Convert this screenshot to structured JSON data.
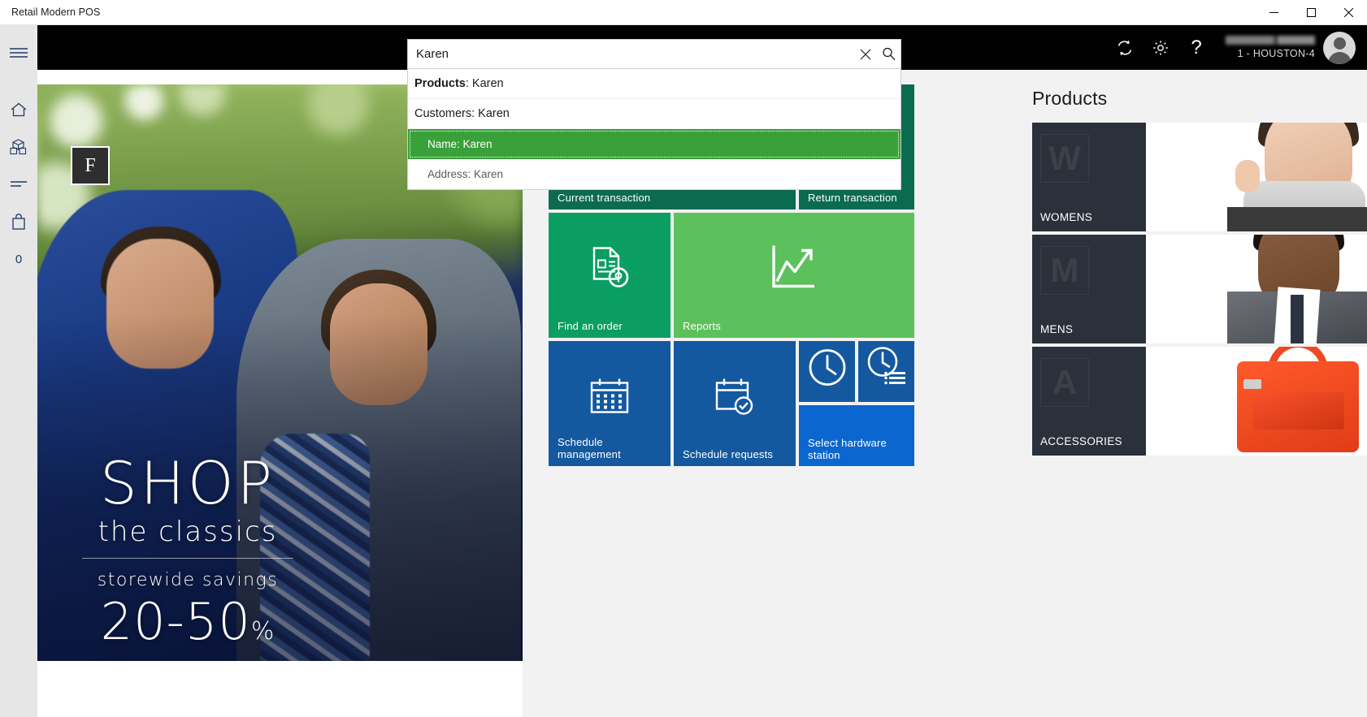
{
  "window": {
    "title": "Retail Modern POS",
    "minimize_label": "Minimize",
    "maximize_label": "Maximize",
    "close_label": "Close"
  },
  "rail": {
    "menu_label": "Menu",
    "items": [
      {
        "name": "home",
        "label": "Home"
      },
      {
        "name": "products",
        "label": "Products"
      },
      {
        "name": "list",
        "label": "Transactions"
      },
      {
        "name": "cart",
        "label": "Cart"
      }
    ],
    "cart_count": "0"
  },
  "search": {
    "value": "Karen",
    "placeholder": "Search",
    "clear_label": "Clear",
    "search_label": "Search",
    "suggestions": [
      {
        "type": "group",
        "bold": "Products",
        "rest": ": Karen"
      },
      {
        "type": "group",
        "bold": "",
        "rest": "Customers: Karen"
      },
      {
        "type": "child",
        "text": "Name: Karen",
        "selected": true
      },
      {
        "type": "child",
        "text": "Address: Karen",
        "selected": false
      }
    ]
  },
  "header": {
    "sync_label": "Sync",
    "settings_label": "Settings",
    "help_label": "Help",
    "user_name": "",
    "store": "1 - HOUSTON-4",
    "avatar_label": "User account"
  },
  "banner": {
    "logo": "F",
    "headline": "SHOP",
    "subhead": "the classics",
    "promo_line": "storewide  savings",
    "discount": "20-50",
    "discount_unit": "%"
  },
  "tiles": [
    {
      "name": "current-transaction",
      "label": "Current transaction",
      "icon": "cart-icon",
      "color": "#0b6b4f"
    },
    {
      "name": "return-transaction",
      "label": "Return transaction",
      "icon": "return-icon",
      "color": "#0b6b4f"
    },
    {
      "name": "find-an-order",
      "label": "Find an order",
      "icon": "document-search-icon",
      "color": "#0a9e62"
    },
    {
      "name": "reports",
      "label": "Reports",
      "icon": "chart-up-icon",
      "color": "#5cc15c"
    },
    {
      "name": "schedule-management",
      "label": "Schedule management",
      "icon": "calendar-icon",
      "color": "#14599f"
    },
    {
      "name": "schedule-requests",
      "label": "Schedule requests",
      "icon": "calendar-check-icon",
      "color": "#14599f"
    },
    {
      "name": "time-clock",
      "label": "",
      "icon": "clock-icon",
      "color": "#14599f"
    },
    {
      "name": "time-clock-entries",
      "label": "",
      "icon": "clock-list-icon",
      "color": "#14599f"
    },
    {
      "name": "select-hardware-station",
      "label": "Select hardware station",
      "icon": "",
      "color": "#0b66cf"
    }
  ],
  "products": {
    "title": "Products",
    "items": [
      {
        "name": "womens",
        "label": "WOMENS",
        "initial": "W"
      },
      {
        "name": "mens",
        "label": "MENS",
        "initial": "M"
      },
      {
        "name": "accessories",
        "label": "ACCESSORIES",
        "initial": "A"
      }
    ]
  }
}
